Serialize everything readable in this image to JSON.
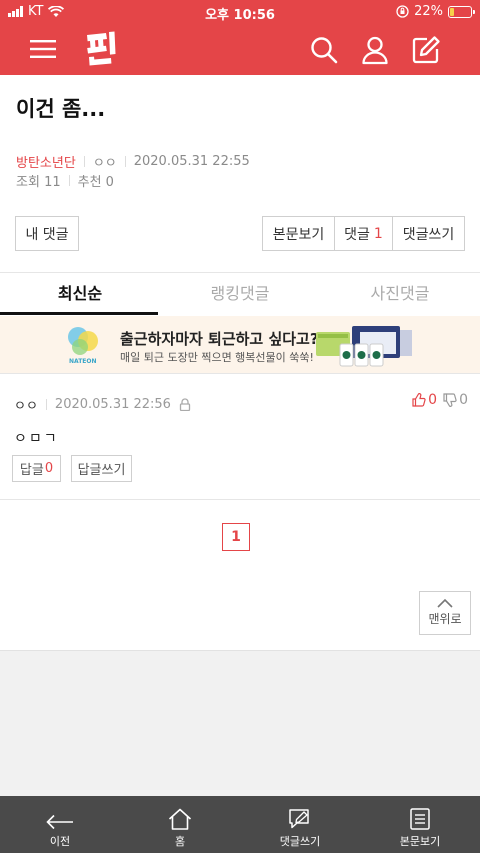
{
  "status_bar": {
    "carrier": "KT",
    "time": "오후 10:56",
    "battery": "22%",
    "battery_level": 0.22
  },
  "post": {
    "title": "이건 좀...",
    "author": "방탄소년단",
    "nickname": "ㅇㅇ",
    "datetime": "2020.05.31 22:55",
    "views_label": "조회",
    "views": "11",
    "recommend_label": "추천",
    "recommend": "0"
  },
  "actions": {
    "my_comments": "내 댓글",
    "view_post": "본문보기",
    "comments_label": "댓글",
    "comments_count": "1",
    "write_comment": "댓글쓰기"
  },
  "tabs": [
    {
      "label": "최신순",
      "active": true
    },
    {
      "label": "랭킹댓글",
      "active": false
    },
    {
      "label": "사진댓글",
      "active": false
    }
  ],
  "ad": {
    "title": "출근하자마자 퇴근하고 싶다고?",
    "subtitle": "매일 퇴근 도장만 찍으면 행복선물이 쑥쑥!",
    "brand": "NATEON"
  },
  "comment": {
    "user": "ㅇㅇ",
    "datetime": "2020.05.31 22:56",
    "likes": "0",
    "dislikes": "0",
    "text": "ㅇㅁㄱ",
    "reply_label": "답글",
    "reply_count": "0",
    "write_reply": "답글쓰기"
  },
  "pagination": {
    "current": "1"
  },
  "to_top_label": "맨위로",
  "bottom_nav": [
    {
      "label": "이전",
      "icon": "back-arrow-icon"
    },
    {
      "label": "홈",
      "icon": "home-icon"
    },
    {
      "label": "댓글쓰기",
      "icon": "write-comment-icon"
    },
    {
      "label": "본문보기",
      "icon": "document-icon"
    }
  ],
  "colors": {
    "brand_red": "#e44548",
    "nav_bg": "#4a4a4a",
    "banner_bg": "#fdf4ea"
  }
}
